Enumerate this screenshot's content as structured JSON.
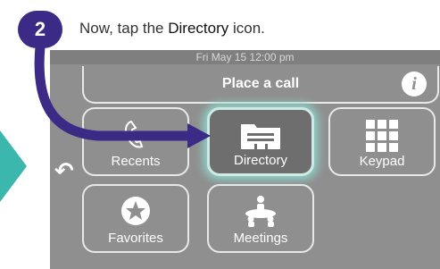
{
  "step": {
    "number": "2"
  },
  "instruction": {
    "prefix": "Now, tap the ",
    "emphasis": "Directory",
    "suffix": " icon."
  },
  "screen": {
    "status_time": "Fri May 15 12:00 pm",
    "place_call_label": "Place a call",
    "tiles": {
      "recents": "Recents",
      "directory": "Directory",
      "keypad": "Keypad",
      "favorites": "Favorites",
      "meetings": "Meetings"
    }
  },
  "colors": {
    "badge": "#3c2a87",
    "accent_teal": "#3cb7ad",
    "screen_bg": "#8f8f8f"
  }
}
